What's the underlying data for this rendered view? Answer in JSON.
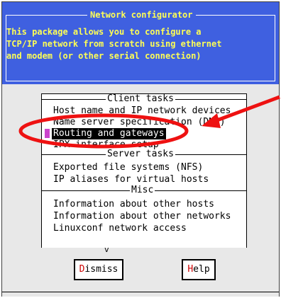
{
  "window": {
    "title": "Network configurator",
    "description": [
      "This package allows you to configure a",
      "TCP/IP network from scratch using ethernet",
      "and modem (or other serial connection)"
    ]
  },
  "sections": [
    {
      "title": "Client tasks",
      "items": [
        {
          "label": "Host name and IP network devices",
          "selected": false
        },
        {
          "label": "Name server specification (DNS)",
          "selected": false
        },
        {
          "label": "Routing and gateways",
          "selected": true
        },
        {
          "label": "IPX interface setup",
          "selected": false
        }
      ]
    },
    {
      "title": "Server tasks",
      "items": [
        {
          "label": "Exported file systems (NFS)",
          "selected": false
        },
        {
          "label": "IP aliases for virtual hosts",
          "selected": false
        }
      ]
    },
    {
      "title": "Misc",
      "items": [
        {
          "label": "Information about other hosts",
          "selected": false
        },
        {
          "label": "Information about other networks",
          "selected": false
        },
        {
          "label": "Linuxconf network access",
          "selected": false
        }
      ]
    }
  ],
  "scroll_indicator": "v",
  "buttons": {
    "dismiss": {
      "hotkey": "D",
      "rest": "ismiss"
    },
    "help": {
      "hotkey": "H",
      "rest": "elp"
    }
  },
  "colors": {
    "header_bg": "#3f60e0",
    "header_text": "#ffff55",
    "annotation": "#ee1111",
    "selection_marker": "#cc44cc"
  }
}
